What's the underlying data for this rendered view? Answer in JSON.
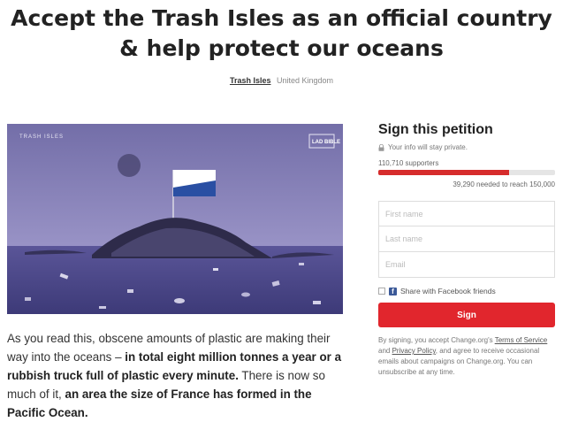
{
  "header": {
    "title": "Accept the Trash Isles as an official country & help protect our oceans",
    "author": "Trash Isles",
    "location": "United Kingdom"
  },
  "hero": {
    "logo_left": "TRASH ISLES",
    "logo_right": "LAD BIBLE"
  },
  "story": {
    "p1_a": "As you read this, obscene amounts of plastic are making their way into the oceans – ",
    "p1_b": "in total eight million tonnes a year or a rubbish truck full of plastic every minute.",
    "p1_c": " There is now so much of it, ",
    "p1_d": "an area the size of France has formed in the Pacific Ocean."
  },
  "petition": {
    "heading": "Sign this petition",
    "privacy_note": "Your info will stay private.",
    "supporters": "110,710 supporters",
    "progress_fraction": 0.74,
    "needed": "39,290 needed to reach 150,000",
    "first_name_placeholder": "First name",
    "last_name_placeholder": "Last name",
    "email_placeholder": "Email",
    "facebook_label": "Share with Facebook friends",
    "sign_button": "Sign",
    "disclaimer_a": "By signing, you accept Change.org's ",
    "terms_link": "Terms of Service",
    "disclaimer_b": " and ",
    "privacy_link": "Privacy Policy",
    "disclaimer_c": ", and agree to receive occasional emails about campaigns on Change.org. You can unsubscribe at any time."
  },
  "colors": {
    "accent": "#e1262d",
    "progress": "#d62c2c",
    "facebook": "#3b5998",
    "hero_sky": "#6f6aa6",
    "hero_sea": "#4a4688"
  }
}
